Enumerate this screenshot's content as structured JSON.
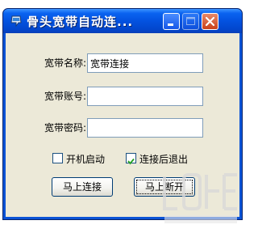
{
  "window": {
    "title": "骨头宽带自动连..."
  },
  "icons": {
    "app": "broadband-icon",
    "minimize": "minimize-icon",
    "maximize": "maximize-icon",
    "close": "close-icon"
  },
  "form": {
    "name_label": "宽带名称:",
    "name_value": "宽带连接",
    "account_label": "宽带账号:",
    "account_value": "",
    "password_label": "宽带密码:",
    "password_value": ""
  },
  "options": {
    "startup_label": "开机启动",
    "startup_checked": false,
    "exit_after_connect_label": "连接后退出",
    "exit_after_connect_checked": true
  },
  "buttons": {
    "connect": "马上连接",
    "disconnect": "马上断开"
  },
  "colors": {
    "titlebar": "#0352e0",
    "dialog_bg": "#ece9d8",
    "close_button": "#c9401a"
  }
}
